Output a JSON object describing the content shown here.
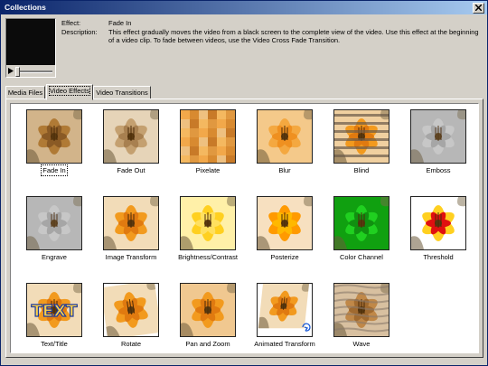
{
  "window": {
    "title": "Collections",
    "close_icon": "close-icon"
  },
  "effect": {
    "effect_label": "Effect:",
    "effect_value": "Fade In",
    "description_label": "Description:",
    "description_value": "This effect gradually moves the video from a black screen to the complete view of the video. Use this effect at the beginning of a video clip. To fade between videos, use the Video Cross Fade Transition."
  },
  "tabs": [
    {
      "label": "Media Files",
      "active": false
    },
    {
      "label": "Video Effects",
      "active": true
    },
    {
      "label": "Video Transitions",
      "active": false
    }
  ],
  "effects": [
    {
      "label": "Fade In",
      "style": "fadein",
      "selected": true
    },
    {
      "label": "Fade Out",
      "style": "fadeout",
      "selected": false
    },
    {
      "label": "Pixelate",
      "style": "pixelate",
      "selected": false
    },
    {
      "label": "Blur",
      "style": "blur",
      "selected": false
    },
    {
      "label": "Blind",
      "style": "blind",
      "selected": false
    },
    {
      "label": "Emboss",
      "style": "emboss",
      "selected": false
    },
    {
      "label": "Engrave",
      "style": "engrave",
      "selected": false
    },
    {
      "label": "Image Transform",
      "style": "transform",
      "selected": false
    },
    {
      "label": "Brightness/Contrast",
      "style": "bright",
      "selected": false
    },
    {
      "label": "Posterize",
      "style": "posterize",
      "selected": false
    },
    {
      "label": "Color Channel",
      "style": "green",
      "selected": false
    },
    {
      "label": "Threshold",
      "style": "threshold",
      "selected": false
    },
    {
      "label": "Text/Title",
      "style": "text",
      "text_overlay": "TEXT",
      "selected": false
    },
    {
      "label": "Rotate",
      "style": "rotate",
      "selected": false
    },
    {
      "label": "Pan and Zoom",
      "style": "pan",
      "selected": false
    },
    {
      "label": "Animated Transform",
      "style": "animated",
      "selected": false
    },
    {
      "label": "Wave",
      "style": "wave",
      "selected": false
    }
  ],
  "colors": {
    "titlebar_start": "#0a246a",
    "titlebar_end": "#a6caf0",
    "face": "#d4d0c8",
    "lily_orange": "#f29a1e",
    "lily_yellow": "#ffd020",
    "channel_green": "#18c018",
    "threshold_red": "#e01010"
  }
}
